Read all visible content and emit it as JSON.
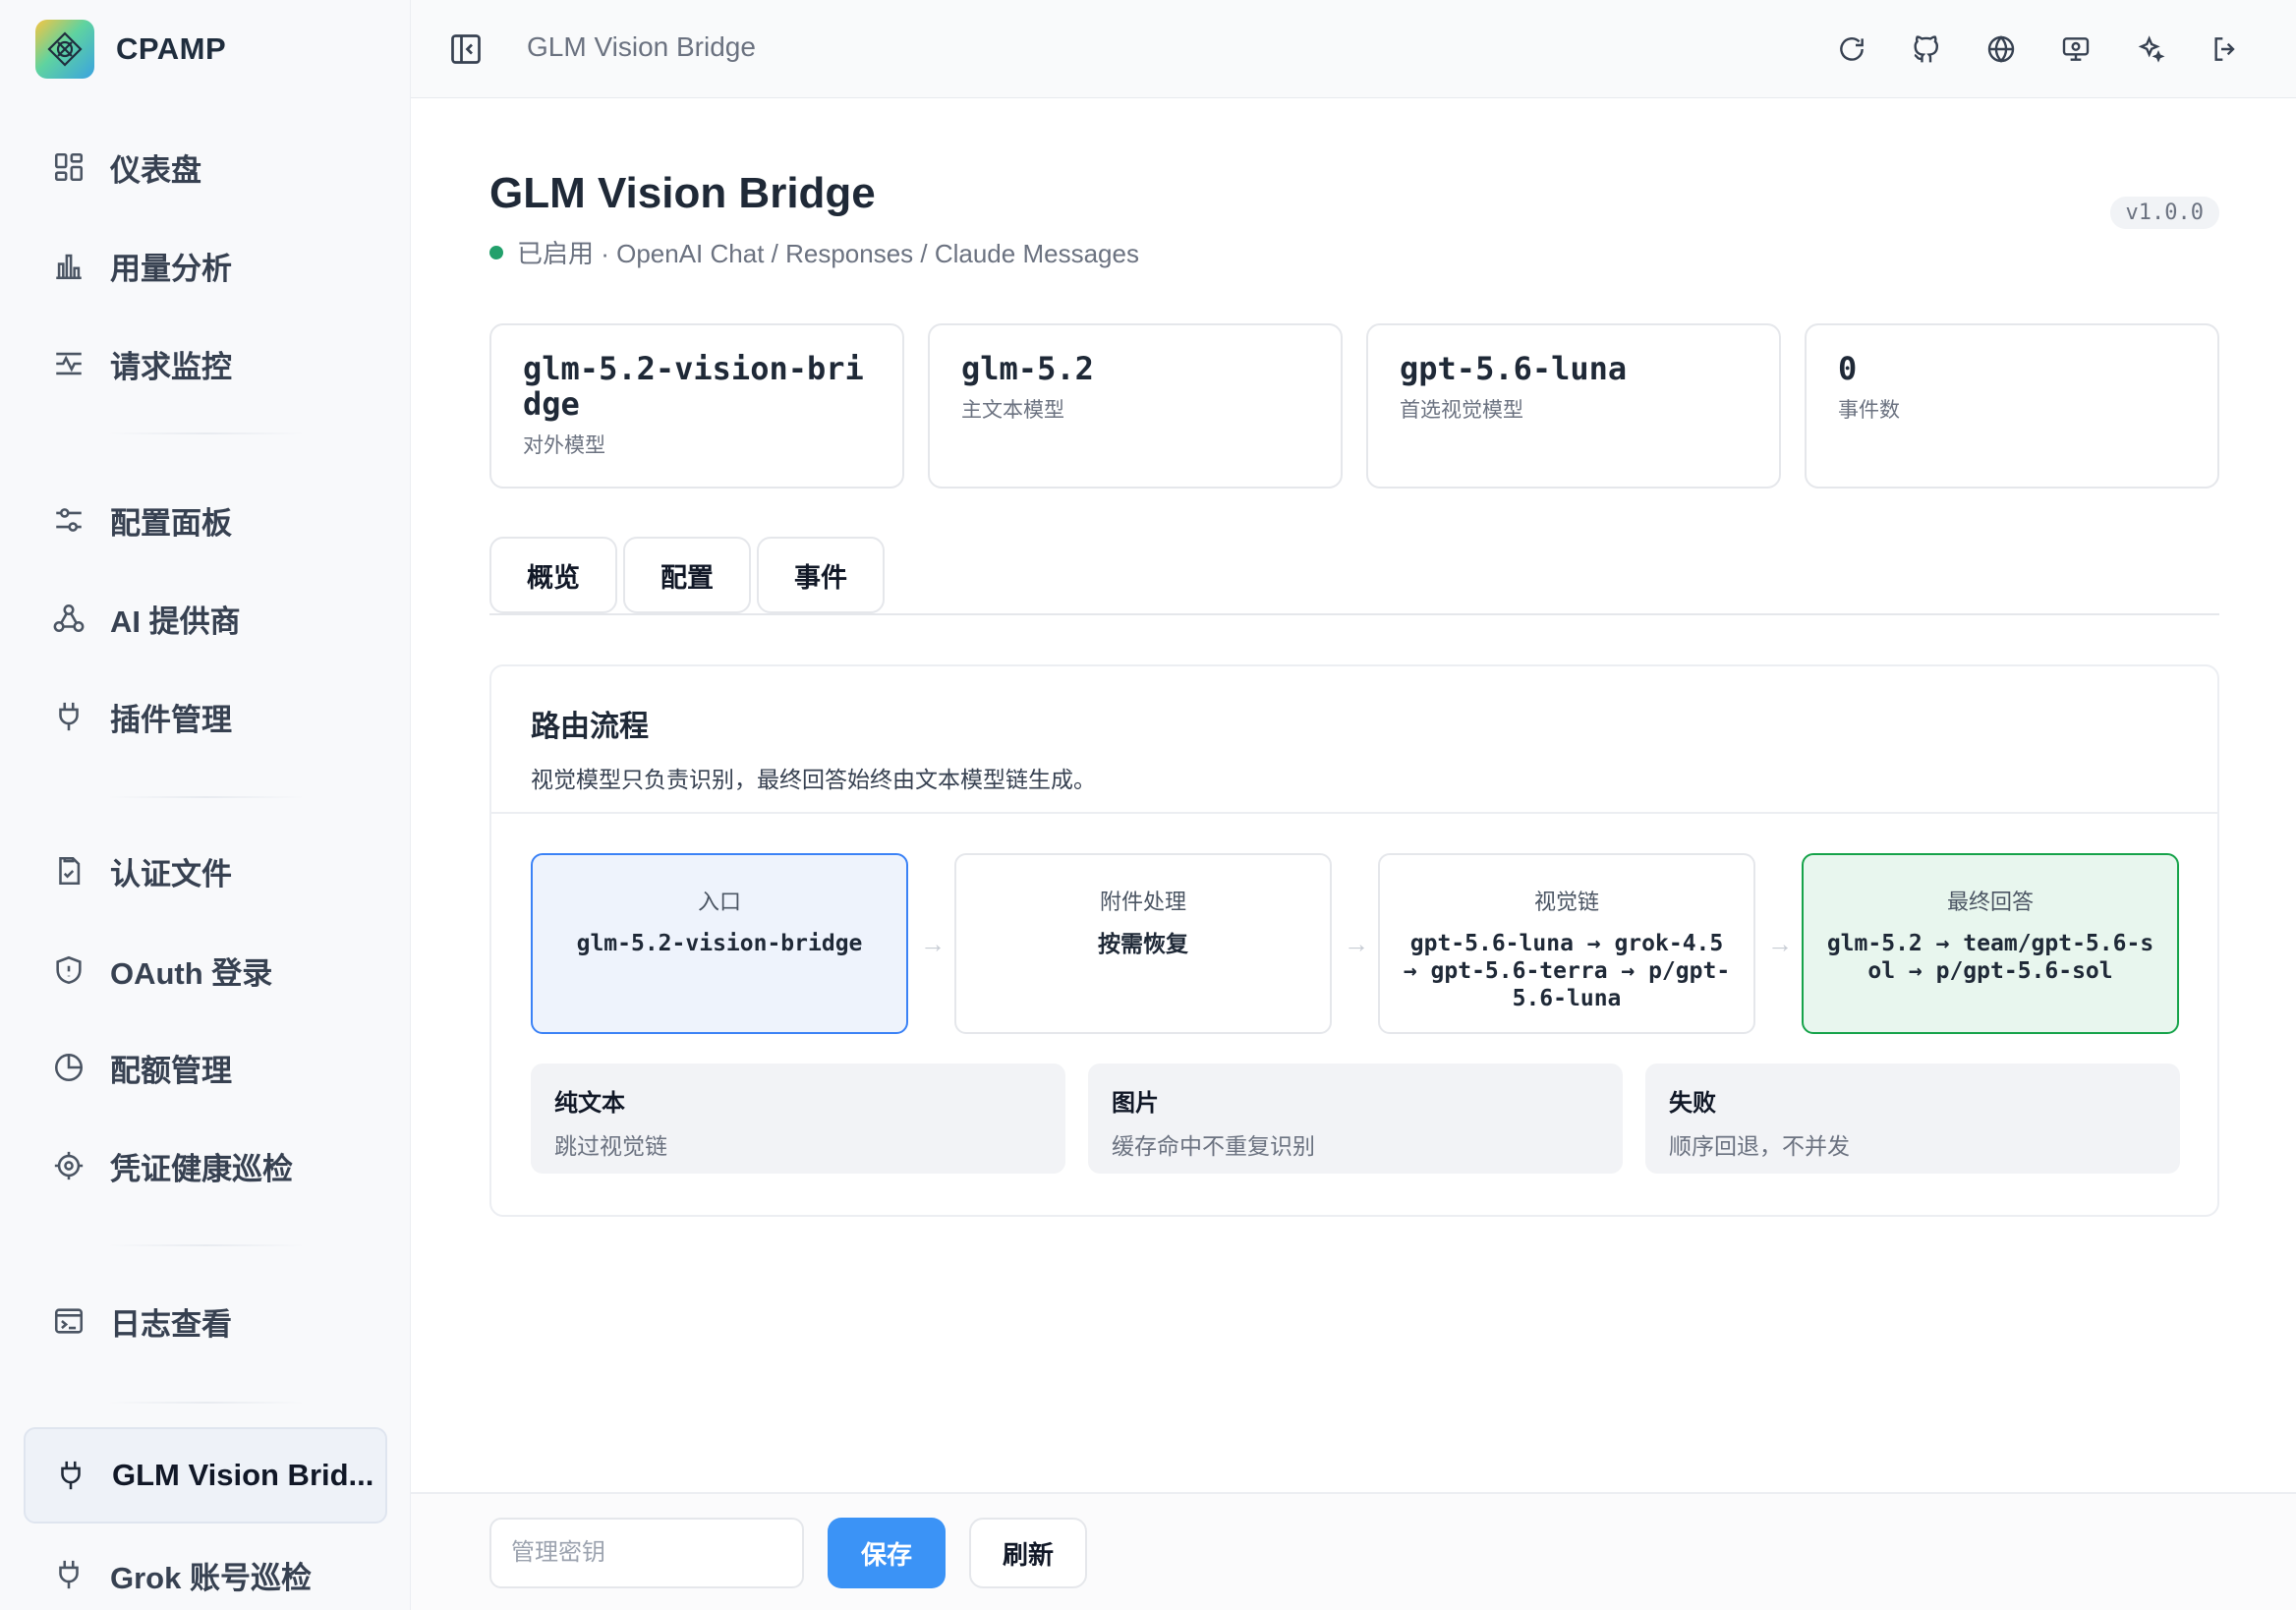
{
  "app": {
    "name": "CPAMP"
  },
  "sidebar": {
    "items": [
      {
        "label": "仪表盘",
        "icon": "dashboard-icon"
      },
      {
        "label": "用量分析",
        "icon": "bar-chart-icon"
      },
      {
        "label": "请求监控",
        "icon": "activity-icon"
      },
      {
        "label": "配置面板",
        "icon": "sliders-icon"
      },
      {
        "label": "AI 提供商",
        "icon": "network-icon"
      },
      {
        "label": "插件管理",
        "icon": "plug-icon"
      },
      {
        "label": "认证文件",
        "icon": "file-check-icon"
      },
      {
        "label": "OAuth 登录",
        "icon": "shield-icon"
      },
      {
        "label": "配额管理",
        "icon": "pie-chart-icon"
      },
      {
        "label": "凭证健康巡检",
        "icon": "crosshair-icon"
      },
      {
        "label": "日志查看",
        "icon": "terminal-icon"
      },
      {
        "label": "GLM Vision Brid...",
        "icon": "plug-icon",
        "active": true
      },
      {
        "label": "Grok 账号巡检",
        "icon": "plug-icon"
      }
    ]
  },
  "header": {
    "title": "GLM Vision Bridge",
    "actions": [
      "refresh-icon",
      "github-icon",
      "globe-icon",
      "monitor-icon",
      "sparkles-icon",
      "logout-icon"
    ]
  },
  "page": {
    "title": "GLM Vision Bridge",
    "status": "已启用 · OpenAI Chat / Responses / Claude Messages",
    "status_color": "#22a06b",
    "version": "v1.0.0"
  },
  "stats": [
    {
      "value": "glm-5.2-vision-bridge",
      "label": "对外模型"
    },
    {
      "value": "glm-5.2",
      "label": "主文本模型"
    },
    {
      "value": "gpt-5.6-luna",
      "label": "首选视觉模型"
    },
    {
      "value": "0",
      "label": "事件数"
    }
  ],
  "tabs": [
    "概览",
    "配置",
    "事件"
  ],
  "route": {
    "title": "路由流程",
    "desc": "视觉模型只负责识别，最终回答始终由文本模型链生成。",
    "steps": [
      {
        "label": "入口",
        "value": "glm-5.2-vision-bridge"
      },
      {
        "label": "附件处理",
        "value": "按需恢复"
      },
      {
        "label": "视觉链",
        "value": "gpt-5.6-luna → grok-4.5 → gpt-5.6-terra → p/gpt-5.6-luna"
      },
      {
        "label": "最终回答",
        "value": "glm-5.2 → team/gpt-5.6-sol → p/gpt-5.6-sol"
      }
    ],
    "arrow": "→",
    "notes": [
      {
        "title": "纯文本",
        "desc": "跳过视觉链"
      },
      {
        "title": "图片",
        "desc": "缓存命中不重复识别"
      },
      {
        "title": "失败",
        "desc": "顺序回退，不并发"
      }
    ]
  },
  "footer": {
    "key_placeholder": "管理密钥",
    "save_label": "保存",
    "refresh_label": "刷新"
  },
  "colors": {
    "accent": "#3b93f6",
    "entry_border": "#3b82f6",
    "final_border": "#16a34a"
  }
}
